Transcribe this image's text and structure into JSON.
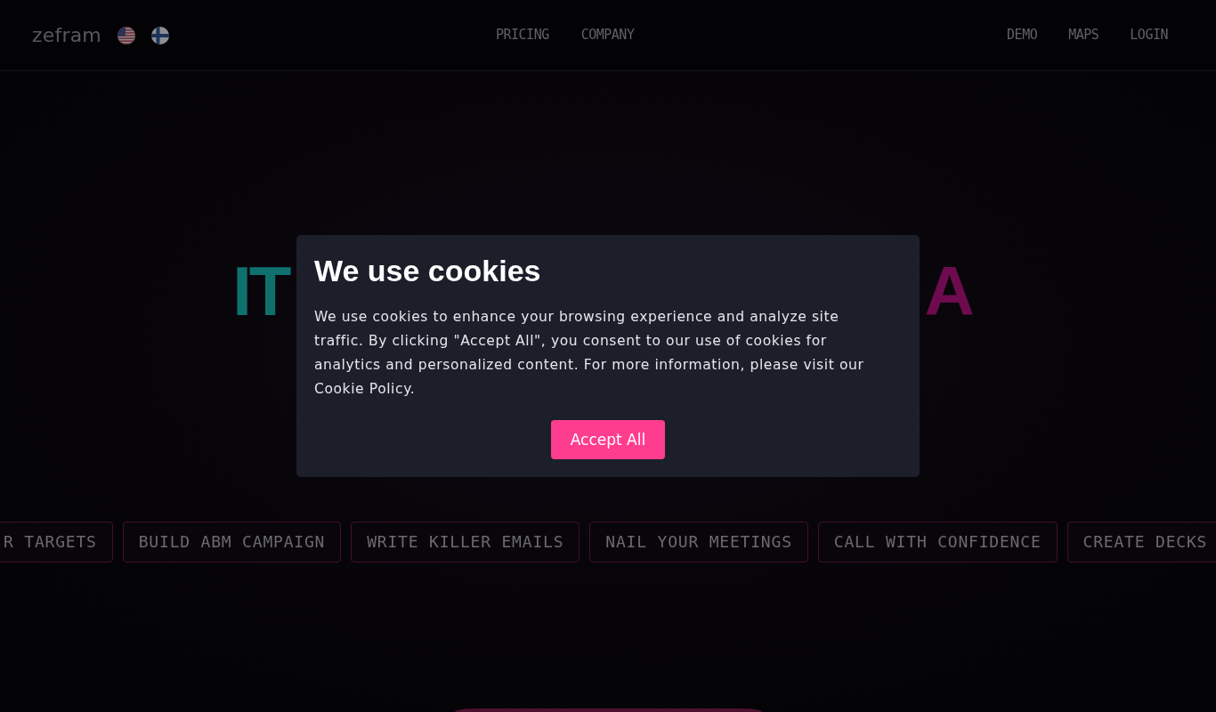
{
  "nav": {
    "logo": "zefram",
    "links": [
      "PRICING",
      "COMPANY"
    ],
    "right_links": [
      "DEMO",
      "MAPS",
      "LOGIN"
    ]
  },
  "hero": {
    "title_left": "IT",
    "title_right": "A",
    "tags": [
      "R TARGETS",
      "BUILD ABM CAMPAIGN",
      "WRITE KILLER EMAILS",
      "NAIL YOUR MEETINGS",
      "CALL WITH CONFIDENCE",
      "CREATE DECKS"
    ]
  },
  "cookie_dialog": {
    "title": "We use cookies",
    "text": "We use cookies to enhance your browsing experience and analyze site traffic. By clicking \"Accept All\", you consent to our use of cookies for analytics and personalized content. For more information, please visit our Cookie Policy.",
    "button": "Accept All"
  }
}
